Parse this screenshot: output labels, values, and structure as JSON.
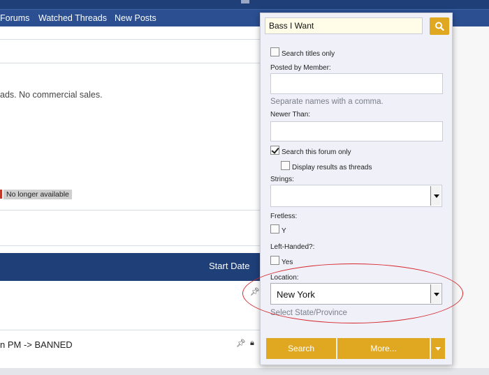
{
  "nav": {
    "items": [
      "Forums",
      "Watched Threads",
      "New Posts"
    ]
  },
  "page": {
    "notice_text": "ads. No commercial sales.",
    "status_tag": "No longer available",
    "column_header": "Start Date",
    "thread_title": "n PM -> BANNED"
  },
  "search_popup": {
    "query": "Bass I Want",
    "search_titles_only": {
      "label": "Search titles only",
      "checked": false
    },
    "posted_by": {
      "label": "Posted by Member:",
      "value": "",
      "hint": "Separate names with a comma."
    },
    "newer_than": {
      "label": "Newer Than:",
      "value": ""
    },
    "search_this_forum": {
      "label": "Search this forum only",
      "checked": true
    },
    "display_as_threads": {
      "label": "Display results as threads",
      "checked": false
    },
    "strings": {
      "label": "Strings:",
      "value": ""
    },
    "fretless": {
      "label": "Fretless:",
      "option": "Y",
      "checked": false
    },
    "left_handed": {
      "label": "Left-Handed?:",
      "option": "Yes",
      "checked": false
    },
    "location": {
      "label": "Location:",
      "value": "New York",
      "hint": "Select State/Province"
    },
    "buttons": {
      "search": "Search",
      "more": "More..."
    }
  },
  "colors": {
    "nav_bar": "#2b4f91",
    "header_band": "#1f3f78",
    "accent_button": "#e0a820",
    "highlight_oval": "#d8252c"
  }
}
